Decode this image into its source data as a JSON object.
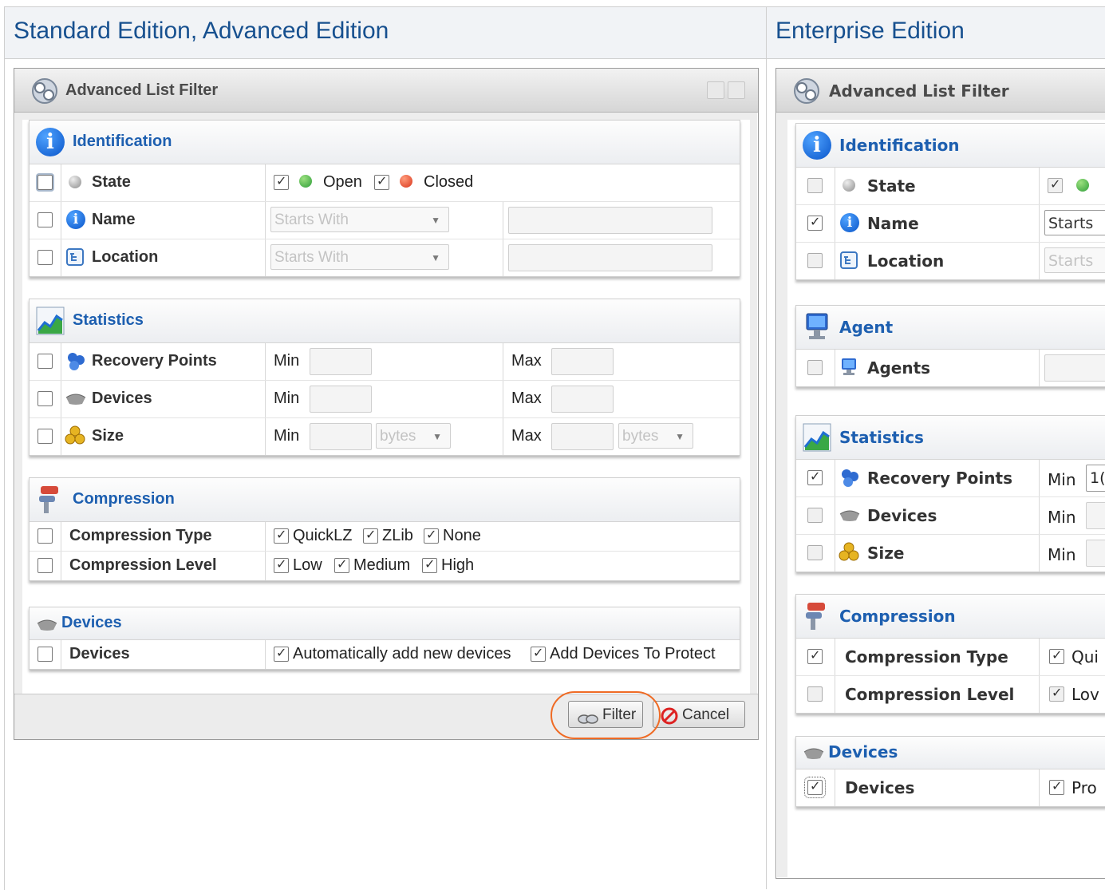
{
  "columns": {
    "left_title": "Standard Edition, Advanced Edition",
    "right_title": "Enterprise Edition"
  },
  "window": {
    "title": "Advanced List Filter"
  },
  "left": {
    "identification": {
      "title": "Identification",
      "state_label": "State",
      "state_open": "Open",
      "state_closed": "Closed",
      "name_label": "Name",
      "name_match": "Starts With",
      "location_label": "Location",
      "location_match": "Starts With"
    },
    "statistics": {
      "title": "Statistics",
      "recovery_points_label": "Recovery Points",
      "devices_label": "Devices",
      "size_label": "Size",
      "min": "Min",
      "max": "Max",
      "unit": "bytes"
    },
    "compression": {
      "title": "Compression",
      "type_label": "Compression Type",
      "type_quicklz": "QuickLZ",
      "type_zlib": "ZLib",
      "type_none": "None",
      "level_label": "Compression Level",
      "level_low": "Low",
      "level_medium": "Medium",
      "level_high": "High"
    },
    "devices": {
      "title": "Devices",
      "devices_label": "Devices",
      "auto_add": "Automatically add new devices",
      "add_protect": "Add Devices To Protect"
    },
    "footer": {
      "filter": "Filter",
      "cancel": "Cancel"
    }
  },
  "right": {
    "identification": {
      "title": "Identification",
      "state_label": "State",
      "name_label": "Name",
      "name_match": "Starts",
      "location_label": "Location",
      "location_match": "Starts"
    },
    "agent": {
      "title": "Agent",
      "agents_label": "Agents"
    },
    "statistics": {
      "title": "Statistics",
      "recovery_points_label": "Recovery Points",
      "recovery_min_value": "1(",
      "devices_label": "Devices",
      "size_label": "Size",
      "min": "Min"
    },
    "compression": {
      "title": "Compression",
      "type_label": "Compression Type",
      "type_partial": "Qui",
      "level_label": "Compression Level",
      "level_partial": "Lov"
    },
    "devices": {
      "title": "Devices",
      "devices_label": "Devices",
      "value_partial": "Pro"
    }
  },
  "colors": {
    "accent": "#1d5fb0",
    "column_title": "#17508f",
    "highlight": "#ef6b25",
    "open_dot": "#3cb34a",
    "closed_dot": "#e4572e"
  }
}
